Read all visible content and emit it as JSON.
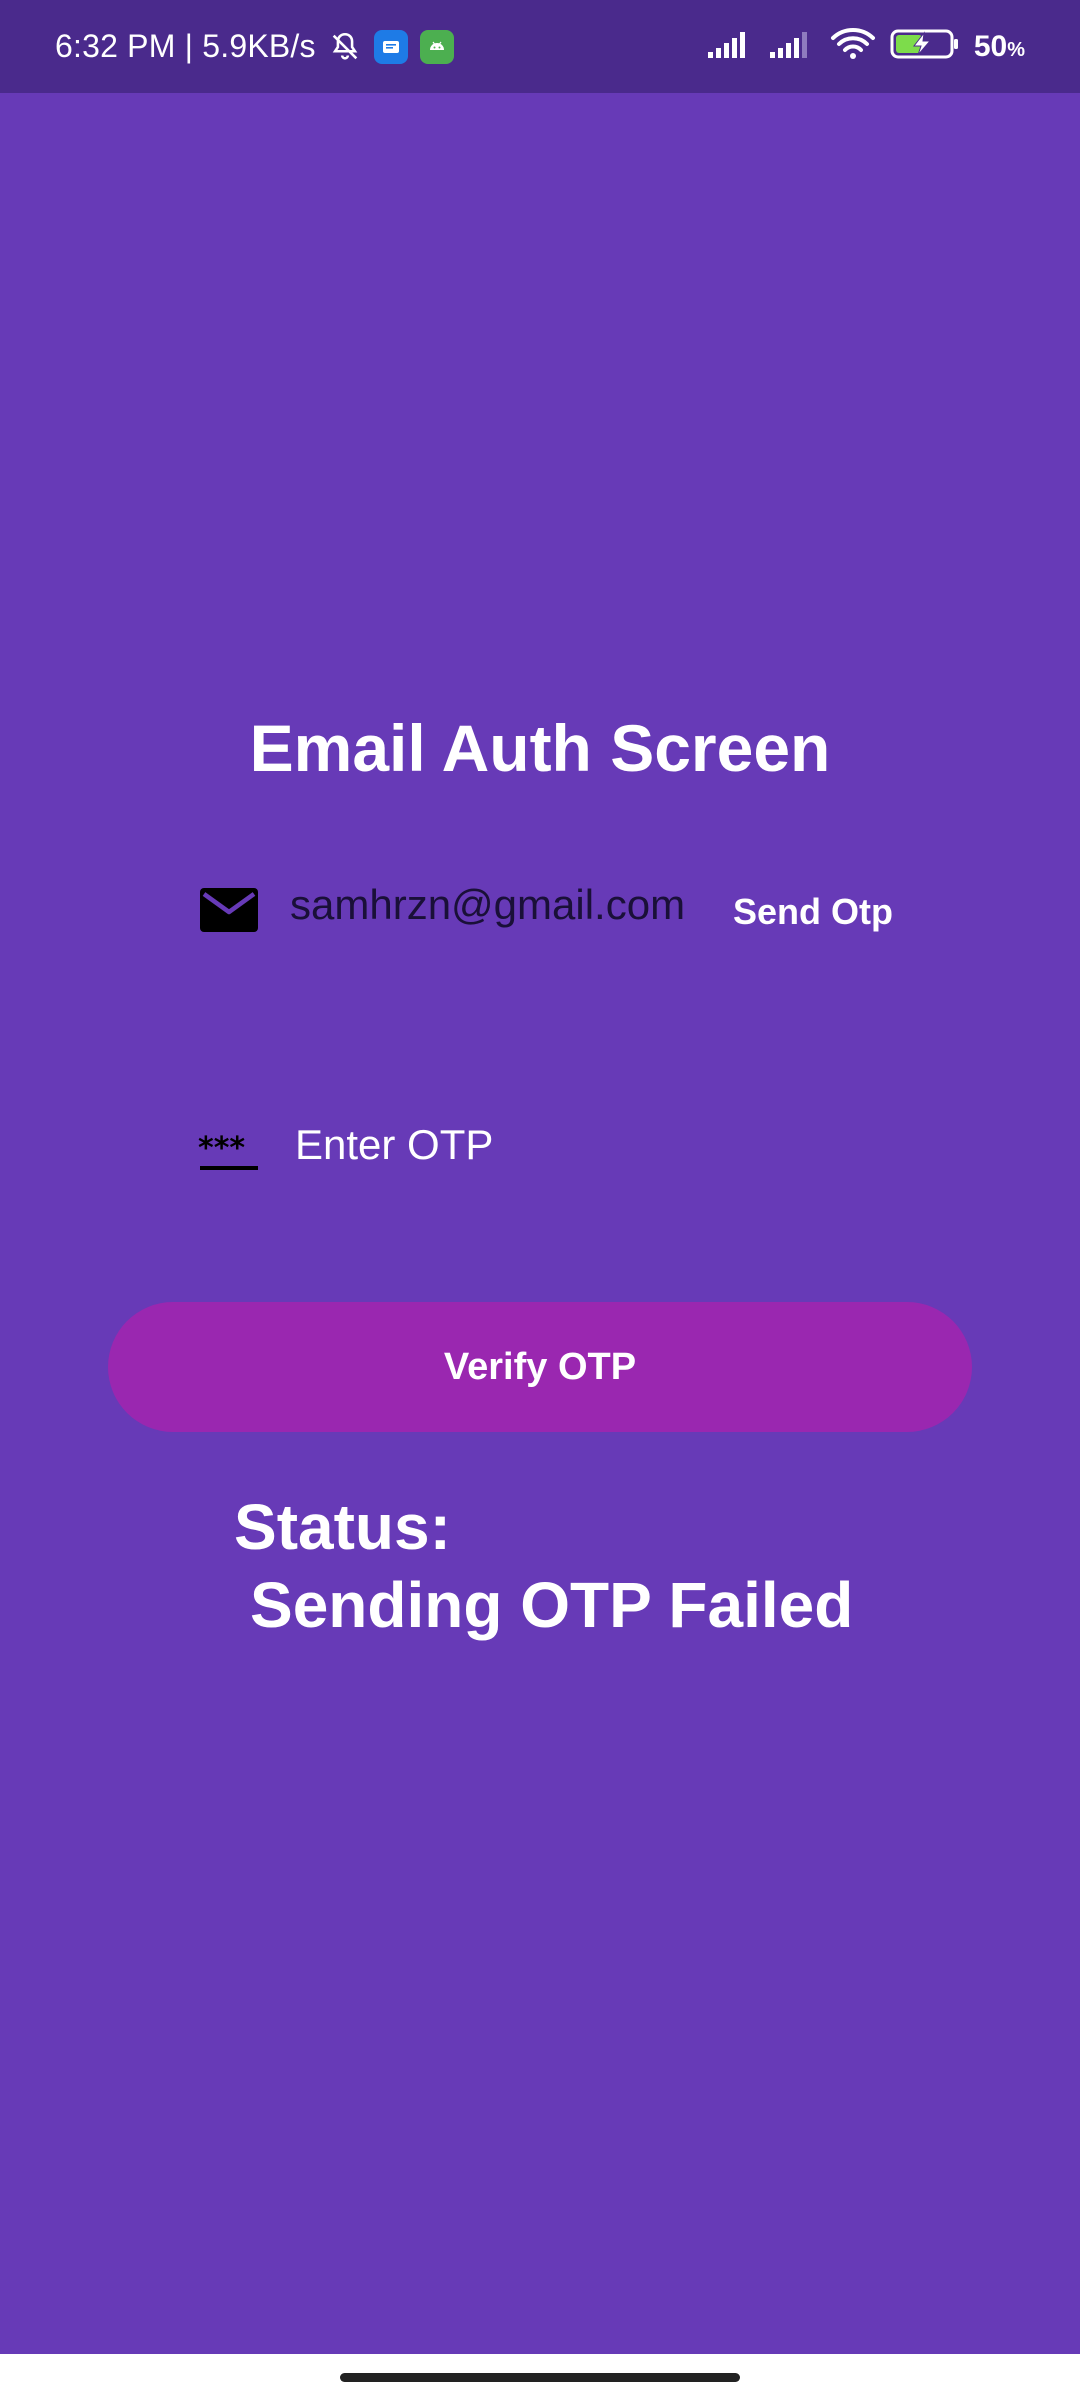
{
  "status_bar": {
    "time_speed": "6:32 PM | 5.9KB/s",
    "battery_percent": "50",
    "battery_unit": "%",
    "battery_level": 0.5,
    "icons": [
      "notifications-off-icon",
      "messages-app-icon",
      "android-app-icon",
      "signal-icon",
      "signal-icon-2",
      "wifi-icon",
      "battery-charging-icon"
    ]
  },
  "screen": {
    "title": "Email Auth Screen",
    "email": {
      "value": "samhrzn@gmail.com",
      "icon": "email-icon"
    },
    "send_otp_label": "Send Otp",
    "otp": {
      "placeholder": "Enter OTP",
      "icon": "password-icon"
    },
    "verify_label": "Verify OTP",
    "status_label": "Status:",
    "status_value": "Sending OTP Failed"
  },
  "colors": {
    "background": "#673AB7",
    "status_bar": "#4A2A8C",
    "button": "#9A27B0",
    "text": "#FFFFFF"
  }
}
